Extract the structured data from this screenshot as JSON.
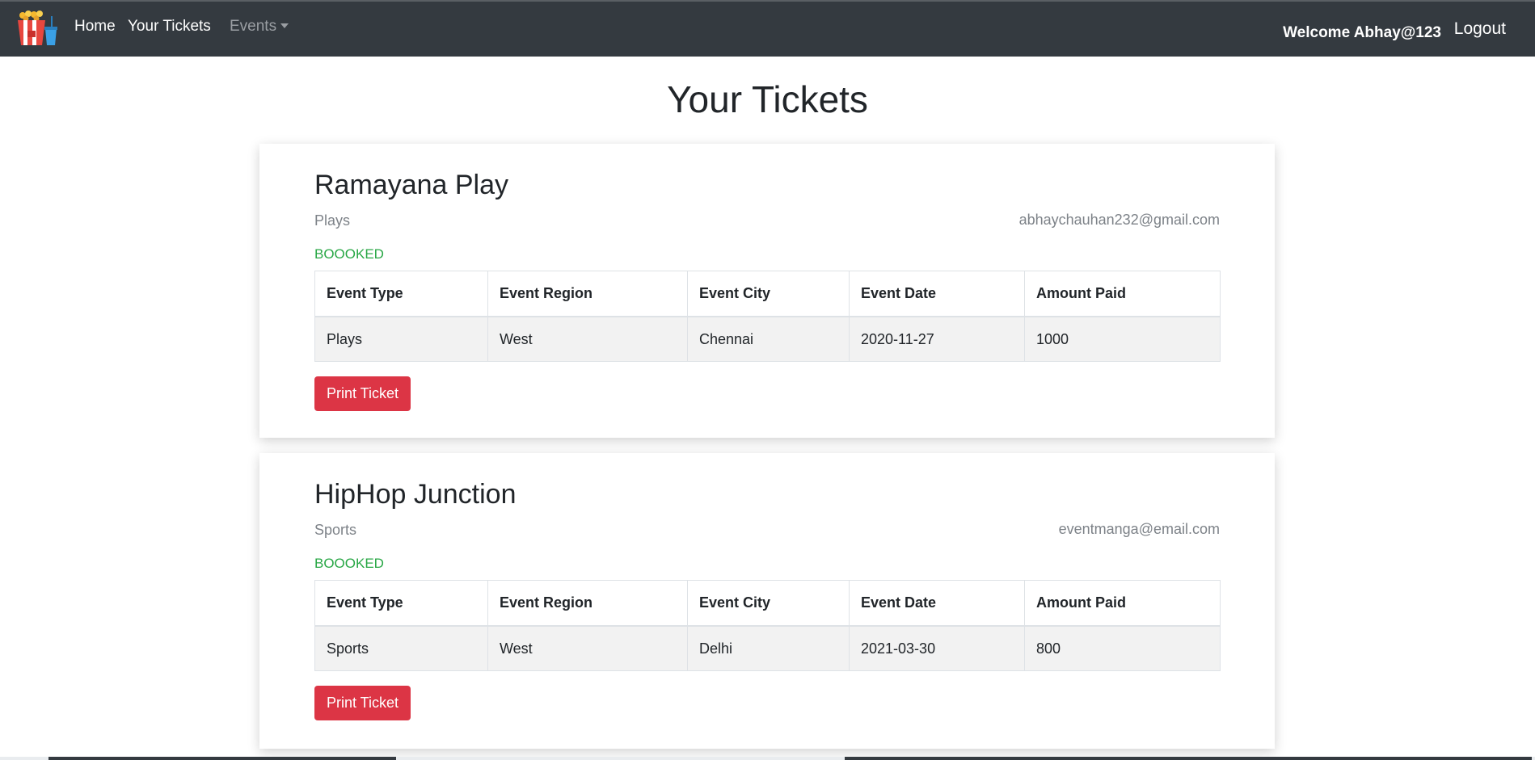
{
  "nav": {
    "home": "Home",
    "your_tickets": "Your Tickets",
    "events": "Events",
    "welcome": "Welcome Abhay@123",
    "logout": "Logout"
  },
  "page": {
    "title": "Your Tickets"
  },
  "table_headers": [
    "Event Type",
    "Event Region",
    "Event City",
    "Event Date",
    "Amount Paid"
  ],
  "tickets": [
    {
      "name": "Ramayana Play",
      "category": "Plays",
      "email": "abhaychauhan232@gmail.com",
      "status": "BOOOKED",
      "row": [
        "Plays",
        "West",
        "Chennai",
        "2020-11-27",
        "1000"
      ],
      "print_label": "Print Ticket"
    },
    {
      "name": "HipHop Junction",
      "category": "Sports",
      "email": "eventmanga@email.com",
      "status": "BOOOKED",
      "row": [
        "Sports",
        "West",
        "Delhi",
        "2021-03-30",
        "800"
      ],
      "print_label": "Print Ticket"
    }
  ],
  "colors": {
    "navbar": "#343a40",
    "booked": "#28a745",
    "print_button": "#dc3545"
  },
  "icons": {
    "logo": "popcorn-cinema-logo-icon",
    "events_dropdown": "caret-down-icon"
  }
}
